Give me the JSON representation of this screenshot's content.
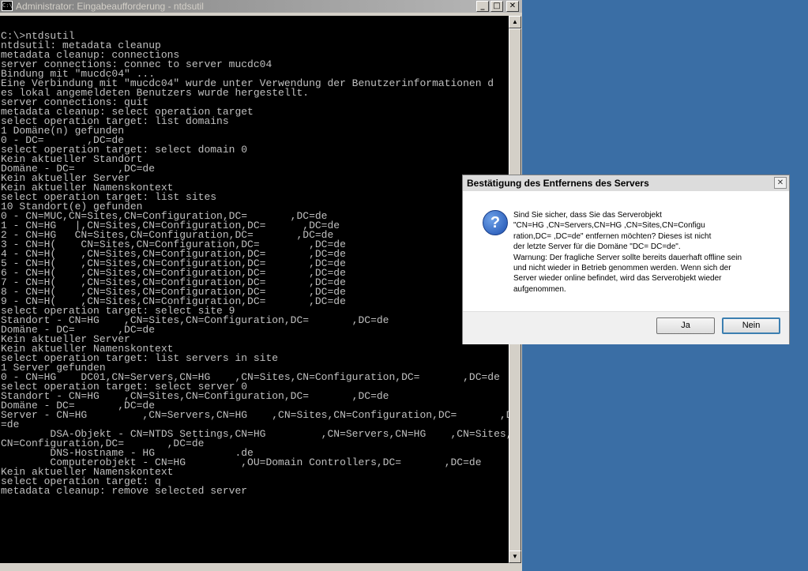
{
  "console": {
    "title": "Administrator: Eingabeaufforderung - ntdsutil",
    "icon_text": "C:\\",
    "controls": {
      "minimize": "_",
      "maximize": "□",
      "close": "✕"
    },
    "lines": [
      "",
      "C:\\>ntdsutil",
      "ntdsutil: metadata cleanup",
      "metadata cleanup: connections",
      "server connections: connec to server mucdc04",
      "Bindung mit \"mucdc04\" ...",
      "Eine Verbindung mit \"mucdc04\" wurde unter Verwendung der Benutzerinformationen d",
      "es lokal angemeldeten Benutzers wurde hergestellt.",
      "server connections: quit",
      "metadata cleanup: select operation target",
      "select operation target: list domains",
      "1 Domäne(n) gefunden",
      "0 - DC=       ,DC=de",
      "select operation target: select domain 0",
      "Kein aktueller Standort",
      "Domäne - DC=       ,DC=de",
      "Kein aktueller Server",
      "Kein aktueller Namenskontext",
      "select operation target: list sites",
      "10 Standort(e) gefunden",
      "0 - CN=MUC,CN=Sites,CN=Configuration,DC=       ,DC=de",
      "1 - CN=HG   |,CN=Sites,CN=Configuration,DC=      ,DC=de",
      "2 - CN=HG   CN=Sites,CN=Configuration,DC=       ,DC=de",
      "3 - CN=H(    CN=Sites,CN=Configuration,DC=        ,DC=de",
      "4 - CN=H(    ,CN=Sites,CN=Configuration,DC=       ,DC=de",
      "5 - CN=H(    ,CN=Sites,CN=Configuration,DC=       ,DC=de",
      "6 - CN=H(    ,CN=Sites,CN=Configuration,DC=       ,DC=de",
      "7 - CN=H(    ,CN=Sites,CN=Configuration,DC=       ,DC=de",
      "8 - CN=H(    ,CN=Sites,CN=Configuration,DC=       ,DC=de",
      "9 - CN=H(    ,CN=Sites,CN=Configuration,DC=       ,DC=de",
      "select operation target: select site 9",
      "Standort - CN=HG    ,CN=Sites,CN=Configuration,DC=       ,DC=de",
      "Domäne - DC=       ,DC=de",
      "Kein aktueller Server",
      "Kein aktueller Namenskontext",
      "select operation target: list servers in site",
      "1 Server gefunden",
      "0 - CN=HG    DC01,CN=Servers,CN=HG    ,CN=Sites,CN=Configuration,DC=       ,DC=de",
      "select operation target: select server 0",
      "Standort - CN=HG    ,CN=Sites,CN=Configuration,DC=       ,DC=de",
      "Domäne - DC=       ,DC=de",
      "Server - CN=HG         ,CN=Servers,CN=HG    ,CN=Sites,CN=Configuration,DC=       ,DC",
      "=de",
      "        DSA-Objekt - CN=NTDS Settings,CN=HG         ,CN=Servers,CN=HG    ,CN=Sites,",
      "CN=Configuration,DC=       ,DC=de",
      "        DNS-Hostname - HG             .de",
      "        Computerobjekt - CN=HG         ,OU=Domain Controllers,DC=       ,DC=de",
      "Kein aktueller Namenskontext",
      "select operation target: q",
      "metadata cleanup: remove selected server"
    ]
  },
  "dialog": {
    "title": "Bestätigung des Entfernens des Servers",
    "close_glyph": "✕",
    "icon_glyph": "?",
    "message_lines": [
      "Sind Sie sicher, dass Sie das Serverobjekt",
      "\"CN=HG           ,CN=Servers,CN=HG      ,CN=Sites,CN=Configu",
      "ration,DC=           ,DC=de\" entfernen möchten? Dieses ist nicht",
      "der letzte Server für die Domäne \"DC=           DC=de\".",
      "Warnung: Der fragliche Server sollte bereits dauerhaft offline sein",
      "und nicht wieder in Betrieb genommen werden. Wenn sich der",
      "Server wieder online befindet, wird das Serverobjekt wieder",
      "aufgenommen."
    ],
    "yes_label": "Ja",
    "no_label": "Nein"
  },
  "colors": {
    "desktop": "#3a6ea5",
    "console_bg": "#000000",
    "console_fg": "#c0c0c0"
  }
}
